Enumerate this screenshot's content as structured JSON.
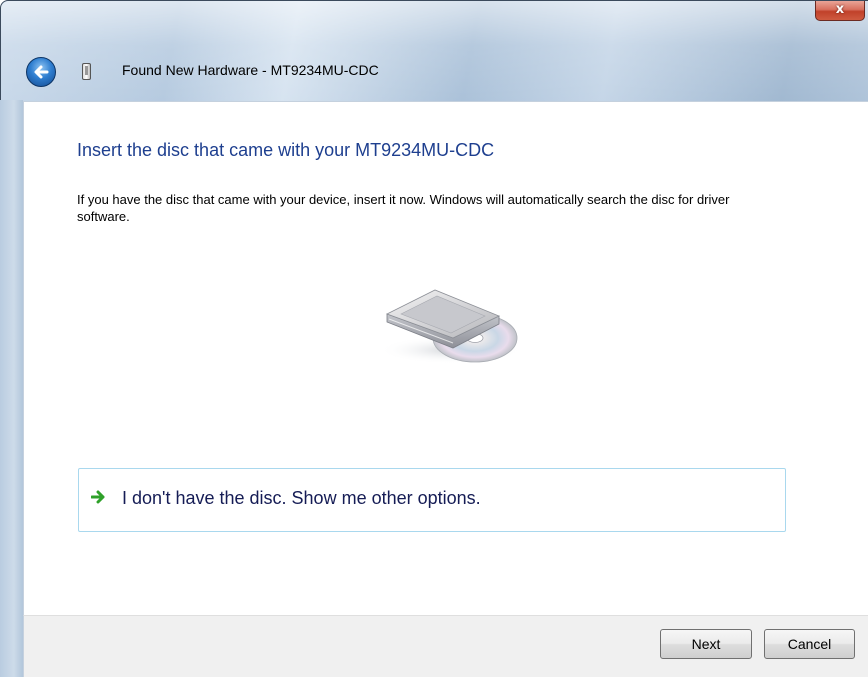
{
  "window": {
    "title": "Found New Hardware - MT9234MU-CDC",
    "close_label": "x"
  },
  "content": {
    "heading": "Insert the disc that came with your MT9234MU-CDC",
    "description": "If you have the disc that came with your device, insert it now.  Windows will automatically search the disc for driver software.",
    "option_text": "I don't have the disc.  Show me other options."
  },
  "buttons": {
    "next": "Next",
    "cancel": "Cancel"
  },
  "icons": {
    "back": "back-arrow-icon",
    "device": "usb-device-icon",
    "disc": "optical-drive-disc-icon",
    "option_arrow": "green-arrow-icon",
    "close": "close-icon"
  },
  "colors": {
    "heading": "#1e3f8f",
    "option_text": "#151c55",
    "option_border": "#a9d8ee",
    "option_arrow": "#2fa12a",
    "close_button": "#c0412a"
  }
}
